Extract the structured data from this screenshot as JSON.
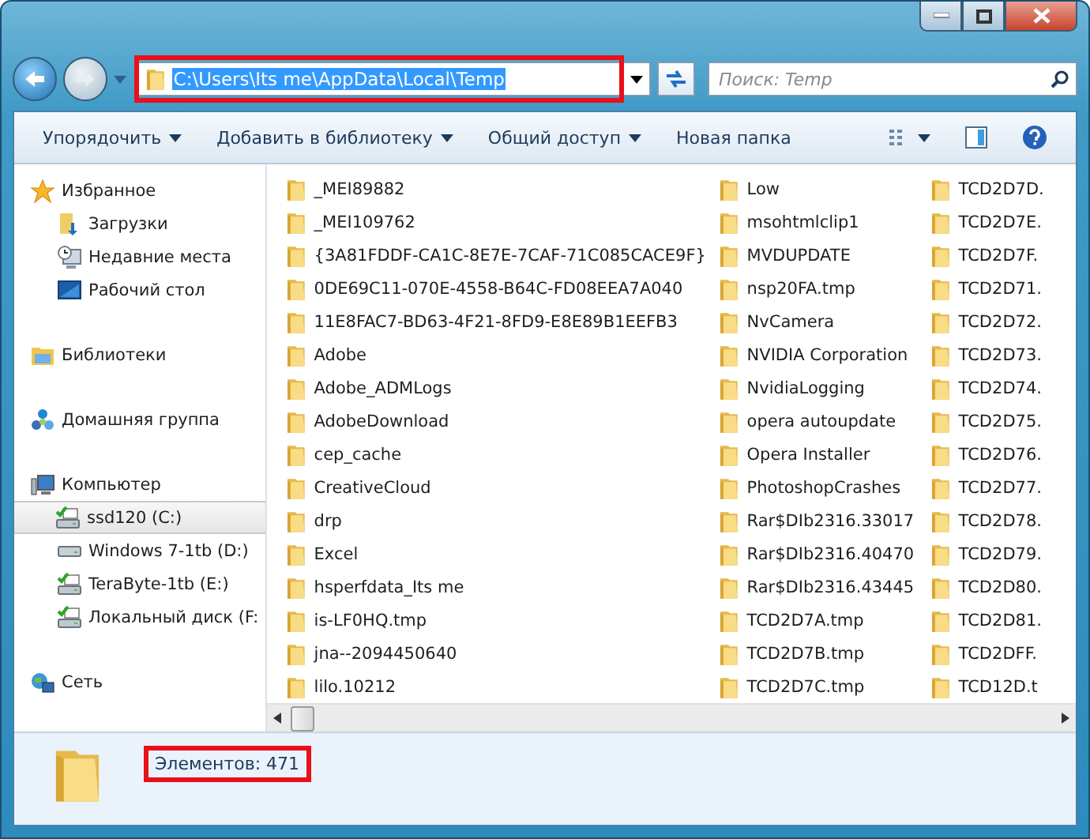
{
  "address_bar": {
    "path": "C:\\Users\\Its me\\AppData\\Local\\Temp",
    "selected": true,
    "highlighted": true
  },
  "search": {
    "placeholder": "Поиск: Temp"
  },
  "toolbar": {
    "buttons": [
      {
        "label": "Упорядочить",
        "dropdown": true
      },
      {
        "label": "Добавить в библиотеку",
        "dropdown": true
      },
      {
        "label": "Общий доступ",
        "dropdown": true
      },
      {
        "label": "Новая папка",
        "dropdown": false
      }
    ]
  },
  "sidebar": {
    "sections": [
      {
        "label": "Избранное",
        "kind": "star",
        "children": [
          {
            "label": "Загрузки",
            "kind": "downloads",
            "selected": false
          },
          {
            "label": "Недавние места",
            "kind": "recent",
            "selected": false
          },
          {
            "label": "Рабочий стол",
            "kind": "desktop",
            "selected": false
          }
        ]
      },
      {
        "label": "Библиотеки",
        "kind": "libraries"
      },
      {
        "label": "Домашняя группа",
        "kind": "homegroup"
      },
      {
        "label": "Компьютер",
        "kind": "computer",
        "children": [
          {
            "label": "ssd120 (C:)",
            "kind": "drive-system",
            "selected": true
          },
          {
            "label": "Windows 7-1tb (D:)",
            "kind": "drive",
            "selected": false
          },
          {
            "label": "TeraByte-1tb (E:)",
            "kind": "drive-system",
            "selected": false
          },
          {
            "label": "Локальный диск (F:",
            "kind": "drive-system",
            "selected": false
          }
        ]
      },
      {
        "label": "Сеть",
        "kind": "network"
      }
    ]
  },
  "files": {
    "columns": [
      [
        "_MEI89882",
        "_MEI109762",
        "{3A81FDDF-CA1C-8E7E-7CAF-71C085CACE9F}",
        "0DE69C11-070E-4558-B64C-FD08EEA7A040",
        "11E8FAC7-BD63-4F21-8FD9-E8E89B1EEFB3",
        "Adobe",
        "Adobe_ADMLogs",
        "AdobeDownload",
        "cep_cache",
        "CreativeCloud",
        "drp",
        "Excel",
        "hsperfdata_Its me",
        "is-LF0HQ.tmp",
        "jna--2094450640",
        "lilo.10212"
      ],
      [
        "Low",
        "msohtmlclip1",
        "MVDUPDATE",
        "nsp20FA.tmp",
        "NvCamera",
        "NVIDIA Corporation",
        "NvidiaLogging",
        "opera autoupdate",
        "Opera Installer",
        "PhotoshopCrashes",
        "Rar$DIb2316.33017",
        "Rar$DIb2316.40470",
        "Rar$DIb2316.43445",
        "TCD2D7A.tmp",
        "TCD2D7B.tmp",
        "TCD2D7C.tmp"
      ],
      [
        "TCD2D7D.",
        "TCD2D7E.",
        "TCD2D7F.",
        "TCD2D71.",
        "TCD2D72.",
        "TCD2D73.",
        "TCD2D74.",
        "TCD2D75.",
        "TCD2D76.",
        "TCD2D77.",
        "TCD2D78.",
        "TCD2D79.",
        "TCD2D80.",
        "TCD2D81.",
        "TCD2DFF.",
        "TCD12D.t"
      ]
    ]
  },
  "status_bar": {
    "count": "Элементов: 471",
    "highlighted": true
  }
}
